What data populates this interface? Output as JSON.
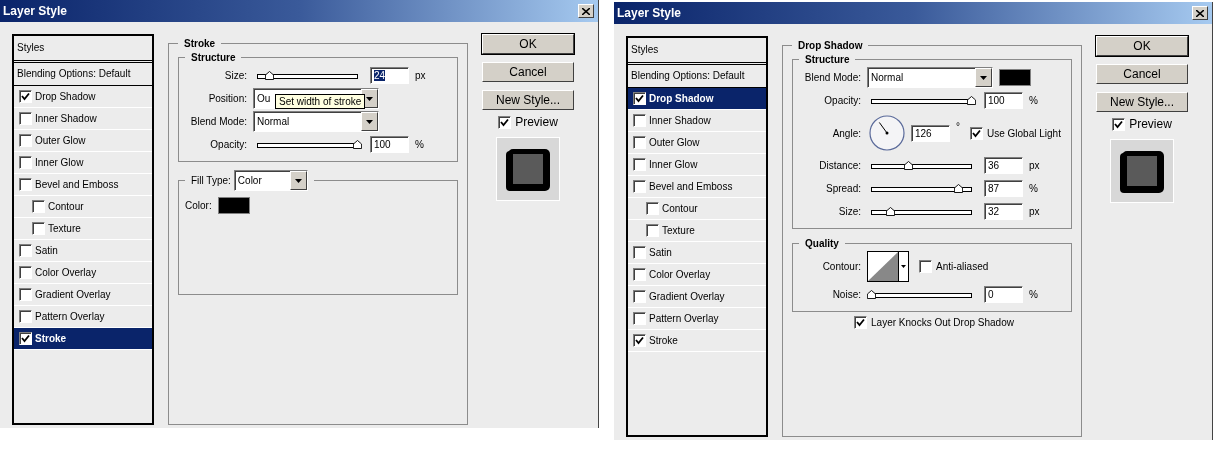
{
  "dialogs": [
    {
      "title": "Layer Style",
      "styles_header": "Styles",
      "blending": "Blending Options: Default",
      "style_items": [
        {
          "label": "Drop Shadow",
          "checked": true,
          "selected": false
        },
        {
          "label": "Inner Shadow",
          "checked": false,
          "selected": false
        },
        {
          "label": "Outer Glow",
          "checked": false,
          "selected": false
        },
        {
          "label": "Inner Glow",
          "checked": false,
          "selected": false
        },
        {
          "label": "Bevel and Emboss",
          "checked": false,
          "selected": false,
          "children": [
            {
              "label": "Contour",
              "checked": false,
              "selected": false
            },
            {
              "label": "Texture",
              "checked": false,
              "selected": false
            }
          ]
        },
        {
          "label": "Satin",
          "checked": false,
          "selected": false
        },
        {
          "label": "Color Overlay",
          "checked": false,
          "selected": false
        },
        {
          "label": "Gradient Overlay",
          "checked": false,
          "selected": false
        },
        {
          "label": "Pattern Overlay",
          "checked": false,
          "selected": false
        },
        {
          "label": "Stroke",
          "checked": true,
          "selected": true
        }
      ],
      "panel": {
        "title": "Stroke",
        "groups": [
          {
            "title": "Structure",
            "rows": [
              {
                "kind": "slider",
                "label": "Size:",
                "level": 0.12,
                "value": "24",
                "unit": "px",
                "highlighted": true
              },
              {
                "kind": "dropdown",
                "label": "Position:",
                "value": "Ou",
                "tooltip": "Set width of stroke"
              },
              {
                "kind": "dropdown",
                "label": "Blend Mode:",
                "value": "Normal"
              },
              {
                "kind": "slider",
                "label": "Opacity:",
                "level": 1,
                "value": "100",
                "unit": "%"
              }
            ]
          },
          {
            "title": "Fill Type:",
            "title_dropdown": "Color",
            "rows": [
              {
                "kind": "swatch",
                "label": "Color:"
              }
            ]
          }
        ]
      },
      "buttons": [
        "OK",
        "Cancel",
        "New Style..."
      ],
      "preview": {
        "label": "Preview",
        "checked": true
      }
    },
    {
      "title": "Layer Style",
      "styles_header": "Styles",
      "blending": "Blending Options: Default",
      "style_items": [
        {
          "label": "Drop Shadow",
          "checked": true,
          "selected": true
        },
        {
          "label": "Inner Shadow",
          "checked": false,
          "selected": false
        },
        {
          "label": "Outer Glow",
          "checked": false,
          "selected": false
        },
        {
          "label": "Inner Glow",
          "checked": false,
          "selected": false
        },
        {
          "label": "Bevel and Emboss",
          "checked": false,
          "selected": false,
          "children": [
            {
              "label": "Contour",
              "checked": false,
              "selected": false
            },
            {
              "label": "Texture",
              "checked": false,
              "selected": false
            }
          ]
        },
        {
          "label": "Satin",
          "checked": false,
          "selected": false
        },
        {
          "label": "Color Overlay",
          "checked": false,
          "selected": false
        },
        {
          "label": "Gradient Overlay",
          "checked": false,
          "selected": false
        },
        {
          "label": "Pattern Overlay",
          "checked": false,
          "selected": false
        },
        {
          "label": "Stroke",
          "checked": true,
          "selected": false
        }
      ],
      "panel": {
        "title": "Drop Shadow",
        "groups": [
          {
            "title": "Structure",
            "rows": [
              {
                "kind": "dropdown",
                "label": "Blend Mode:",
                "value": "Normal",
                "swatch": true
              },
              {
                "kind": "slider",
                "label": "Opacity:",
                "level": 1,
                "value": "100",
                "unit": "%"
              },
              {
                "kind": "angle",
                "label": "Angle:",
                "value": "126",
                "unit": "°",
                "check": {
                  "label": "Use Global Light",
                  "checked": true
                }
              },
              {
                "kind": "slider",
                "label": "Distance:",
                "level": 0.37,
                "value": "36",
                "unit": "px"
              },
              {
                "kind": "slider",
                "label": "Spread:",
                "level": 0.87,
                "value": "87",
                "unit": "%"
              },
              {
                "kind": "slider",
                "label": "Size:",
                "level": 0.19,
                "value": "32",
                "unit": "px"
              }
            ]
          },
          {
            "title": "Quality",
            "rows": [
              {
                "kind": "contour",
                "label": "Contour:",
                "check": {
                  "label": "Anti-aliased",
                  "checked": false
                }
              },
              {
                "kind": "slider",
                "label": "Noise:",
                "level": 0,
                "value": "0",
                "unit": "%"
              }
            ]
          }
        ],
        "footer_check": {
          "label": "Layer Knocks Out Drop Shadow",
          "checked": true
        }
      },
      "buttons": [
        "OK",
        "Cancel",
        "New Style..."
      ],
      "preview": {
        "label": "Preview",
        "checked": true
      }
    }
  ]
}
